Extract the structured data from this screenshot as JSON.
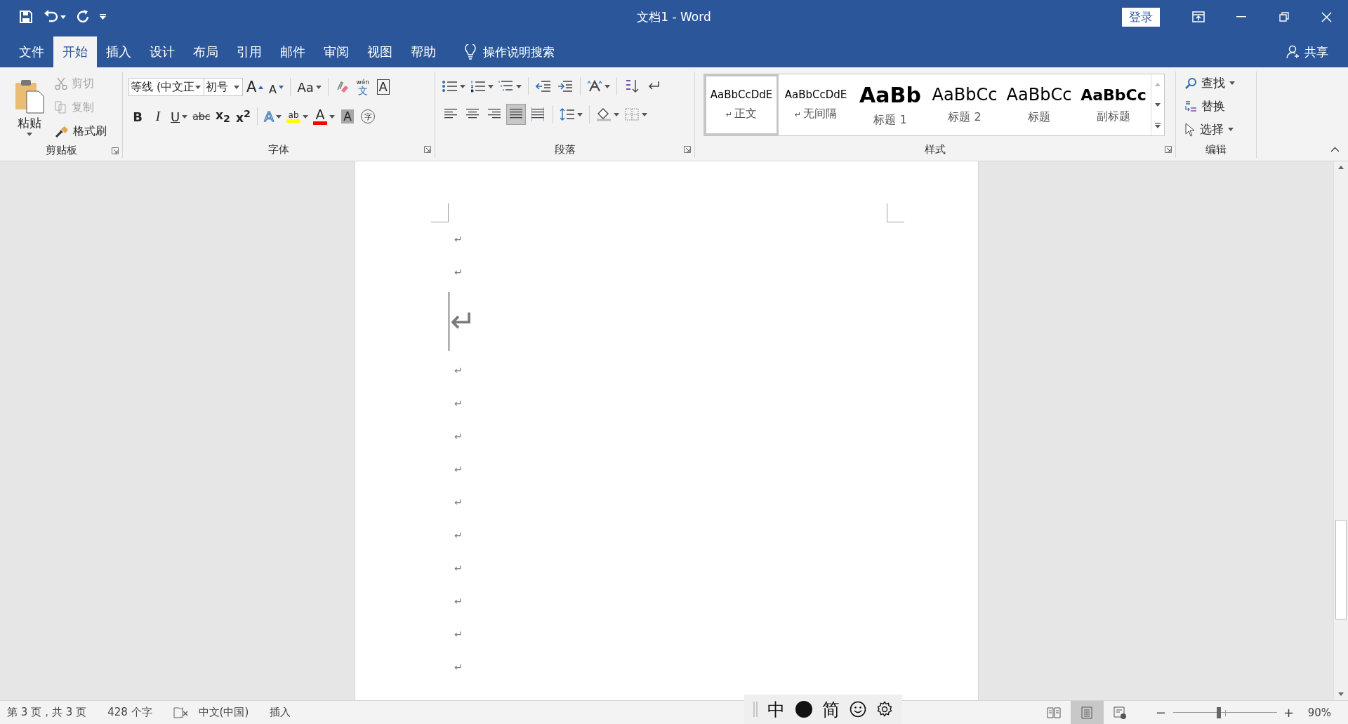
{
  "window": {
    "title": "文档1  -  Word",
    "sign_in": "登录"
  },
  "tabs": [
    {
      "label": "文件",
      "selected": false
    },
    {
      "label": "开始",
      "selected": true
    },
    {
      "label": "插入",
      "selected": false
    },
    {
      "label": "设计",
      "selected": false
    },
    {
      "label": "布局",
      "selected": false
    },
    {
      "label": "引用",
      "selected": false
    },
    {
      "label": "邮件",
      "selected": false
    },
    {
      "label": "审阅",
      "selected": false
    },
    {
      "label": "视图",
      "selected": false
    },
    {
      "label": "帮助",
      "selected": false
    }
  ],
  "tell_me": "操作说明搜索",
  "share": "共享",
  "clipboard": {
    "title": "剪贴板",
    "paste": "粘贴",
    "commands": [
      {
        "kind": "cut",
        "label": "剪切",
        "disabled": true
      },
      {
        "kind": "copy",
        "label": "复制",
        "disabled": true
      },
      {
        "kind": "painter",
        "label": "格式刷",
        "disabled": false
      }
    ]
  },
  "font": {
    "title": "字体",
    "name": "等线 (中文正",
    "size": "初号",
    "row1": [
      {
        "kind": "grow",
        "text": "A"
      },
      {
        "kind": "shrink",
        "text": "A"
      },
      {
        "kind": "case",
        "text": "Aa"
      },
      {
        "kind": "clear"
      },
      {
        "kind": "phonetic",
        "text": "wén",
        "sub": "文"
      },
      {
        "kind": "border",
        "text": "A"
      }
    ],
    "row2": [
      {
        "kind": "bold",
        "text": "B"
      },
      {
        "kind": "italic",
        "text": "I"
      },
      {
        "kind": "underline",
        "text": "U"
      },
      {
        "kind": "strike",
        "text": "abc"
      },
      {
        "kind": "subscript",
        "text": "x$_{2}$"
      },
      {
        "kind": "superscript",
        "text": "x$^{2}$"
      },
      {
        "kind": "effects",
        "text": "A"
      },
      {
        "kind": "highlight",
        "text": "ab",
        "color": "#ffff00"
      },
      {
        "kind": "font_color",
        "text": "A",
        "color": "#ff0000"
      },
      {
        "kind": "shading",
        "text": "A"
      },
      {
        "kind": "enclose",
        "text": "字"
      }
    ]
  },
  "paragraph": {
    "title": "段落",
    "alignments": [
      {
        "kind": "left",
        "selected": false
      },
      {
        "kind": "center",
        "selected": false
      },
      {
        "kind": "right",
        "selected": false
      },
      {
        "kind": "justify",
        "selected": true
      },
      {
        "kind": "distributed",
        "selected": false
      }
    ]
  },
  "styles": {
    "title": "样式",
    "items": [
      {
        "kind": "normal",
        "preview": "AaBbCcDdE",
        "mark": "↵",
        "name": "正文",
        "selected": true
      },
      {
        "kind": "normal",
        "preview": "AaBbCcDdE",
        "mark": "↵",
        "name": "无间隔",
        "selected": false
      },
      {
        "kind": "heading1",
        "preview": "AaBb",
        "name": "标题 1",
        "selected": false
      },
      {
        "kind": "heading2",
        "preview": "AaBbCc",
        "name": "标题 2",
        "selected": false
      },
      {
        "kind": "title",
        "preview": "AaBbCc",
        "name": "标题",
        "selected": false
      },
      {
        "kind": "subtitle",
        "preview": "AaBbCc",
        "name": "副标题",
        "selected": false
      }
    ]
  },
  "editing": {
    "title": "编辑",
    "commands": [
      {
        "kind": "find",
        "label": "查找"
      },
      {
        "kind": "replace",
        "label": "替换"
      },
      {
        "kind": "select",
        "label": "选择"
      }
    ]
  },
  "document": {
    "paragraphs": [
      {
        "kind": "normal",
        "mark": "↵",
        "cursor": false
      },
      {
        "kind": "normal",
        "mark": "↵",
        "cursor": false
      },
      {
        "kind": "large",
        "mark": "↵",
        "cursor": true
      },
      {
        "kind": "normal",
        "mark": "↵",
        "cursor": false
      },
      {
        "kind": "normal",
        "mark": "↵",
        "cursor": false
      },
      {
        "kind": "normal",
        "mark": "↵",
        "cursor": false
      },
      {
        "kind": "normal",
        "mark": "↵",
        "cursor": false
      },
      {
        "kind": "normal",
        "mark": "↵",
        "cursor": false
      },
      {
        "kind": "normal",
        "mark": "↵",
        "cursor": false
      },
      {
        "kind": "normal",
        "mark": "↵",
        "cursor": false
      },
      {
        "kind": "normal",
        "mark": "↵",
        "cursor": false
      },
      {
        "kind": "normal",
        "mark": "↵",
        "cursor": false
      },
      {
        "kind": "normal",
        "mark": "↵",
        "cursor": false
      }
    ]
  },
  "status_bar": {
    "page": "第 3 页，共 3 页",
    "words": "428 个字",
    "language": "中文(中国)",
    "mode": "插入",
    "views": [
      {
        "kind": "read",
        "selected": false
      },
      {
        "kind": "print",
        "selected": true
      },
      {
        "kind": "web",
        "selected": false
      }
    ],
    "zoom_out": "−",
    "zoom_in": "+",
    "zoom": {
      "level": 0.44
    },
    "zoom_percent": "90%"
  },
  "ime": {
    "mode": "中",
    "script": "简"
  }
}
